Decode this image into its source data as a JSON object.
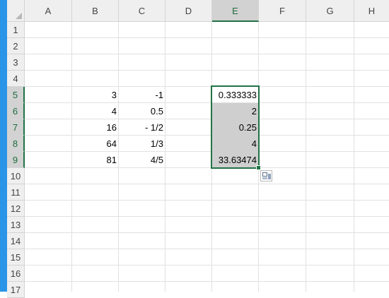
{
  "columns": [
    "A",
    "B",
    "C",
    "D",
    "E",
    "F",
    "G",
    "H"
  ],
  "rows": [
    "1",
    "2",
    "3",
    "4",
    "5",
    "6",
    "7",
    "8",
    "9",
    "10",
    "11",
    "12",
    "13",
    "14",
    "15",
    "16",
    "17"
  ],
  "cells": {
    "B5": "3",
    "C5": "-1",
    "E5": "0.333333",
    "B6": "4",
    "C6": "0.5",
    "E6": "2",
    "B7": "16",
    "C7": "- 1/2",
    "E7": "0.25",
    "B8": "64",
    "C8": "1/3",
    "E8": "4",
    "B9": "81",
    "C9": "4/5",
    "E9": "33.63474"
  },
  "selection": {
    "range": "E5:E9",
    "active_cell": "E5",
    "selected_column": "E",
    "selected_rows": [
      "5",
      "6",
      "7",
      "8",
      "9"
    ]
  },
  "colors": {
    "accent_strip": "#2A95E6",
    "selection_border": "#217346",
    "selection_fill": "#CFCFCF",
    "grid_line": "#E1E1E1",
    "header_bg": "#EFEFEF"
  },
  "icons": {
    "quick_analysis": "quick-analysis-icon"
  }
}
